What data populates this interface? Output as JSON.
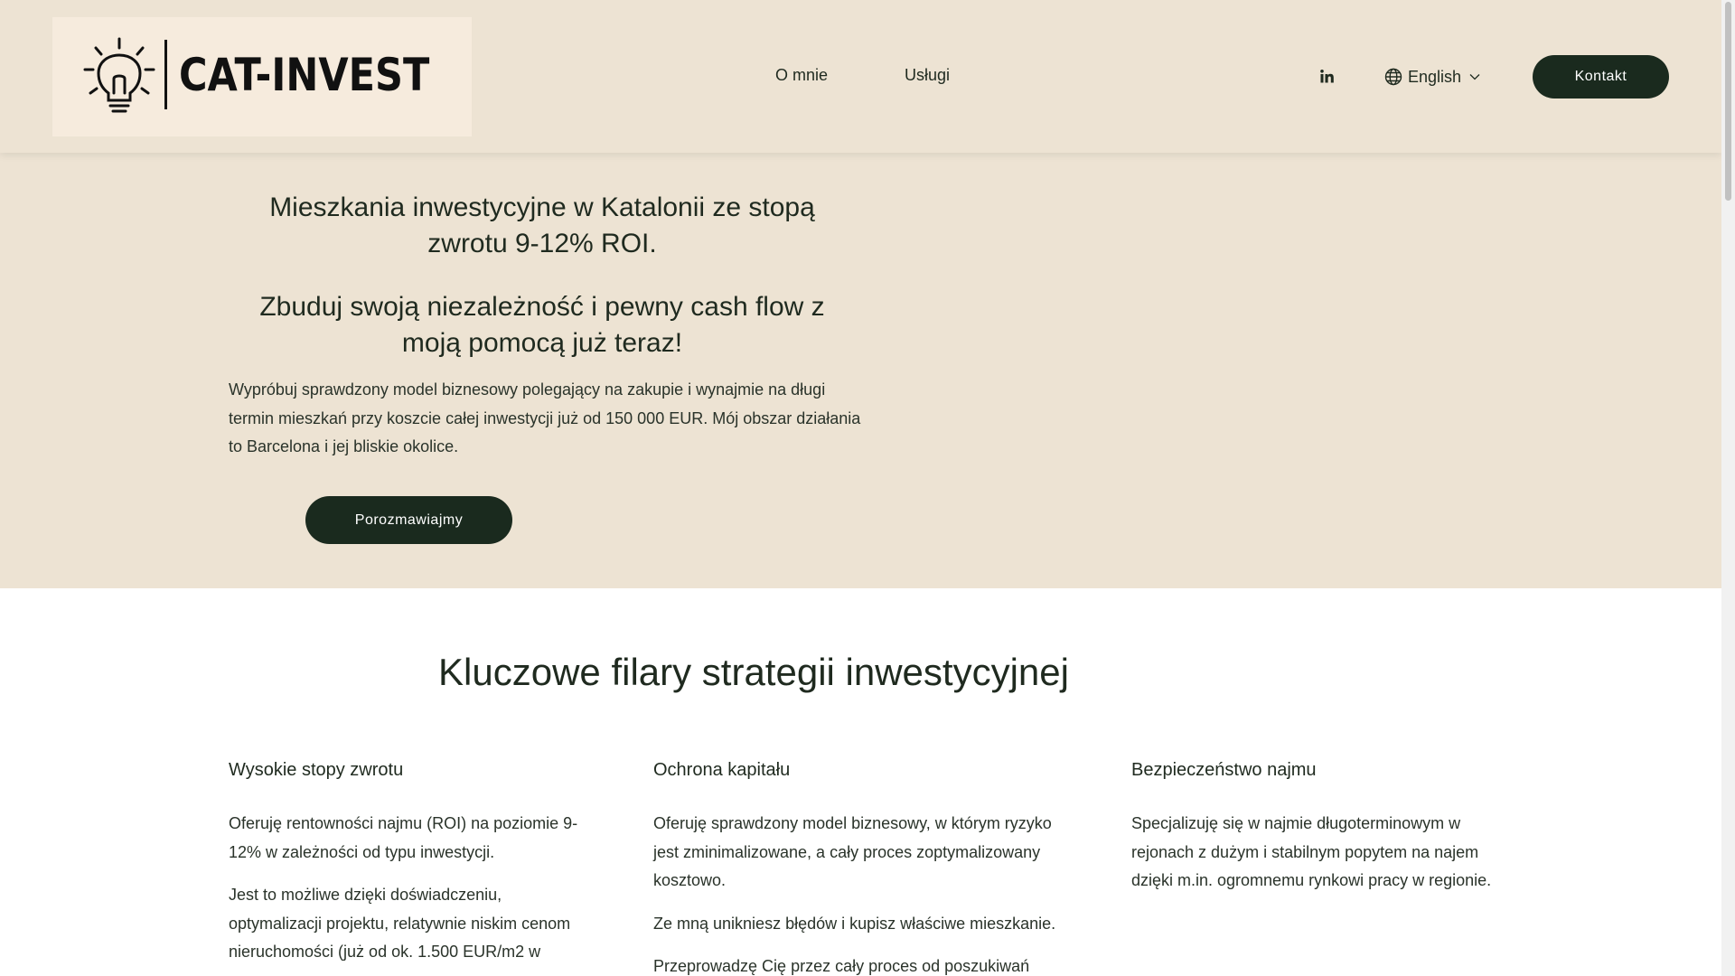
{
  "colors": {
    "hero_bg": "#ede3d3",
    "button_bg": "#1a2a1e",
    "text": "#1f2a1f"
  },
  "header": {
    "logo_text": "CAT-INVEST",
    "logo_icon": "lightbulb-icon",
    "nav": [
      {
        "label": "O mnie"
      },
      {
        "label": "Usługi"
      }
    ],
    "social_icon": "linkedin-icon",
    "language": {
      "label": "English",
      "icon": "globe-icon",
      "chevron": "chevron-down-icon"
    },
    "contact_button": "Kontakt"
  },
  "hero": {
    "title": "Mieszkania inwestycyjne w Katalonii ze stopą zwrotu 9-12% ROI.",
    "subtitle": "Zbuduj swoją niezależność i pewny cash flow z moją pomocą już teraz!",
    "description": "Wypróbuj sprawdzony model biznesowy polegający na zakupie i wynajmie na długi termin mieszkań przy koszcie całej inwestycji już od 150 000 EUR. Mój obszar działania to Barcelona i jej bliskie okolice.",
    "cta": "Porozmawiajmy"
  },
  "pillars": {
    "title": "Kluczowe filary strategii inwestycyjnej",
    "columns": [
      {
        "heading": "Wysokie stopy zwrotu",
        "paragraphs": [
          "Oferuję rentowności najmu (ROI) na poziomie 9-12% w zależności od typu inwestycji.",
          "Jest to możliwe dzięki doświadczeniu, optymalizacji projektu, relatywnie niskim cenom nieruchomości (już od ok. 1.500 EUR/m2 w"
        ]
      },
      {
        "heading": "Ochrona kapitału",
        "paragraphs": [
          "Oferuję sprawdzony model biznesowy, w którym ryzyko jest zminimalizowane, a cały proces zoptymalizowany kosztowo.",
          "Ze mną unikniesz błędów i kupisz właściwe mieszkanie.",
          "Przeprowadzę Cię przez cały proces od poszukiwań"
        ]
      },
      {
        "heading": "Bezpieczeństwo najmu",
        "paragraphs": [
          "Specjalizuję się w najmie długoterminowym w rejonach z dużym i stabilnym popytem na najem dzięki m.in. ogromnemu rynkowi pracy w regionie."
        ]
      }
    ]
  }
}
